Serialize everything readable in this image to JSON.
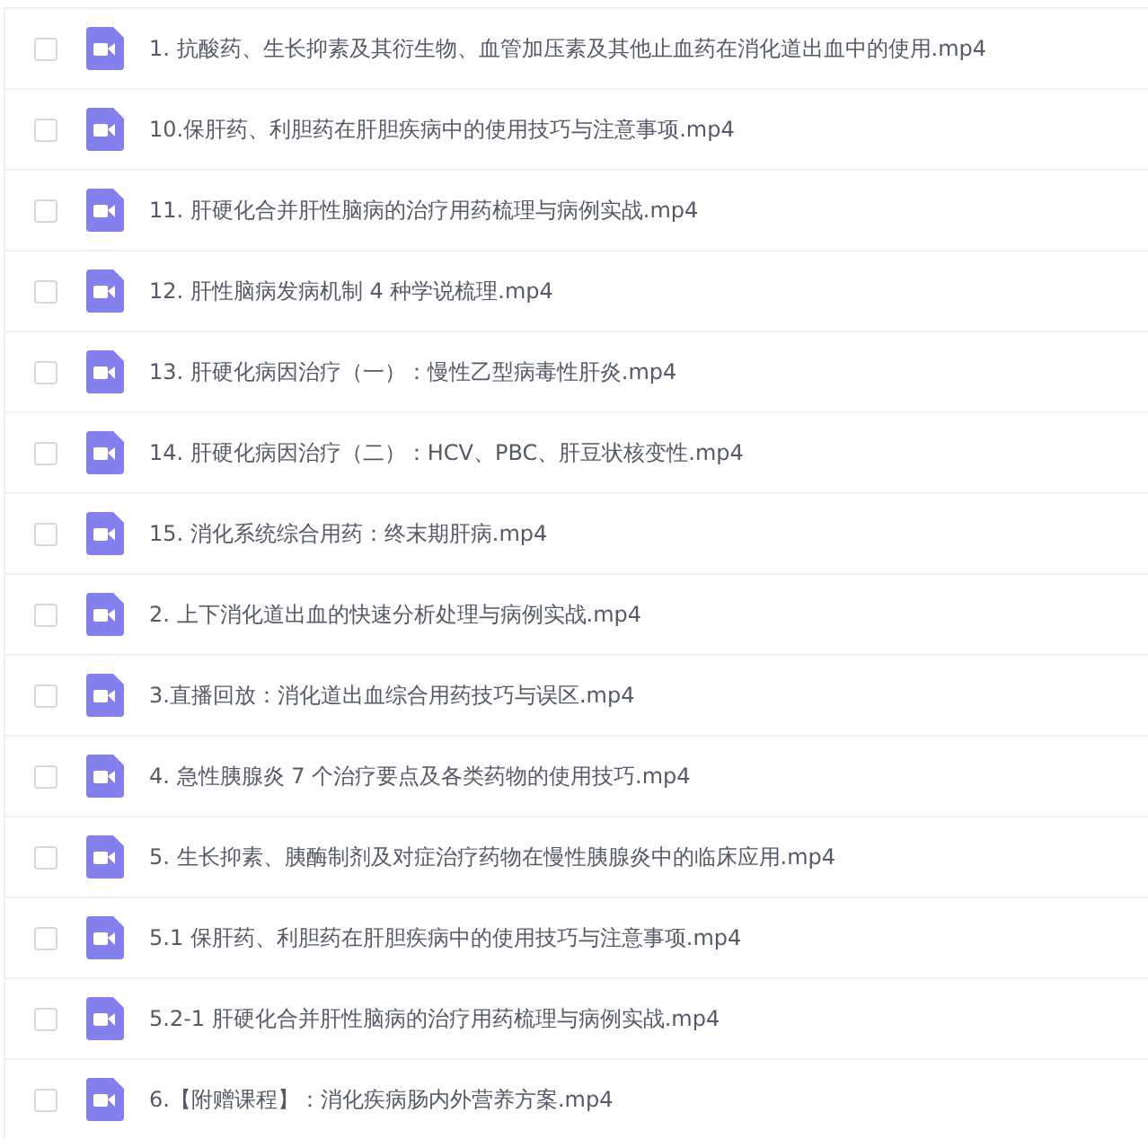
{
  "files": [
    {
      "name": "1. 抗酸药、生长抑素及其衍生物、血管加压素及其他止血药在消化道出血中的使用.mp4",
      "checked": false
    },
    {
      "name": "10.保肝药、利胆药在肝胆疾病中的使用技巧与注意事项.mp4",
      "checked": false
    },
    {
      "name": "11. 肝硬化合并肝性脑病的治疗用药梳理与病例实战.mp4",
      "checked": false
    },
    {
      "name": "12. 肝性脑病发病机制 4 种学说梳理.mp4",
      "checked": false
    },
    {
      "name": "13. 肝硬化病因治疗（一）：慢性乙型病毒性肝炎.mp4",
      "checked": false
    },
    {
      "name": "14. 肝硬化病因治疗（二）：HCV、PBC、肝豆状核变性.mp4",
      "checked": false
    },
    {
      "name": "15. 消化系统综合用药：终末期肝病.mp4",
      "checked": false
    },
    {
      "name": "2. 上下消化道出血的快速分析处理与病例实战.mp4",
      "checked": false
    },
    {
      "name": "3.直播回放：消化道出血综合用药技巧与误区.mp4",
      "checked": false
    },
    {
      "name": "4. 急性胰腺炎 7 个治疗要点及各类药物的使用技巧.mp4",
      "checked": false
    },
    {
      "name": "5. 生长抑素、胰酶制剂及对症治疗药物在慢性胰腺炎中的临床应用.mp4",
      "checked": false
    },
    {
      "name": "5.1 保肝药、利胆药在肝胆疾病中的使用技巧与注意事项.mp4",
      "checked": false
    },
    {
      "name": "5.2-1 肝硬化合并肝性脑病的治疗用药梳理与病例实战.mp4",
      "checked": false
    },
    {
      "name": "6.【附赠课程】：消化疾病肠内外营养方案.mp4",
      "checked": false
    }
  ]
}
